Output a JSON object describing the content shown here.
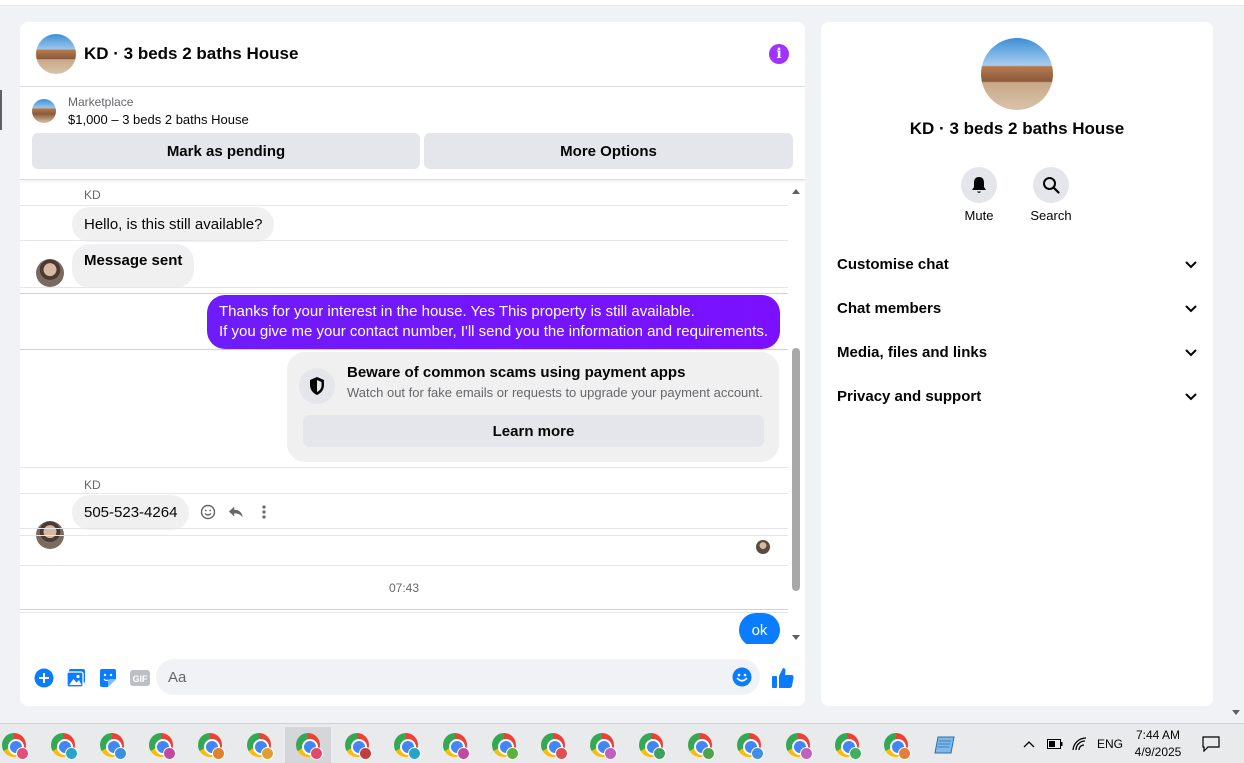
{
  "chat": {
    "title": "KD · 3 beds 2 baths House",
    "listing": {
      "source": "Marketplace",
      "price_title": "$1,000 – 3 beds 2 baths House",
      "mark_pending_label": "Mark as pending",
      "more_options_label": "More Options"
    },
    "messages": {
      "sender1": "KD",
      "msg1": "Hello, is this still available?",
      "msg2": "Message sent",
      "out_line1": "Thanks for your interest in the house. Yes This property is still available.",
      "out_line2": "If you give me your contact number, I'll send you the information and requirements.",
      "scam_title": "Beware of common scams using payment apps",
      "scam_sub": "Watch out for fake emails or requests to upgrade your payment account.",
      "learn_more": "Learn more",
      "sender2": "KD",
      "phone": "505-523-4264",
      "timestamp": "07:43",
      "ok": "ok"
    },
    "composer": {
      "placeholder": "Aa",
      "gif_label": "GIF"
    }
  },
  "side": {
    "title": "KD · 3 beds 2 baths House",
    "mute_label": "Mute",
    "search_label": "Search",
    "sections": [
      "Customise chat",
      "Chat members",
      "Media, files and links",
      "Privacy and support"
    ]
  },
  "taskbar": {
    "lang": "ENG",
    "time": "7:44 AM",
    "date": "4/9/2025",
    "profile_colors": [
      "#e0507a",
      "#2aa3c8",
      "#3b8fe0",
      "#c04aa0",
      "#e08030",
      "#e0a030",
      "#e04a6a",
      "#c04040",
      "#2aa3c8",
      "#c04aa0",
      "#60b040",
      "#e05050",
      "#c060c0",
      "#40a060",
      "#50a050",
      "#4090e0",
      "#c060c0",
      "#40b060",
      "#e08040"
    ]
  },
  "colors": {
    "accent_purple": "#7a1eff",
    "accent_blue": "#0a7cff",
    "info_purple": "#a033ff"
  }
}
